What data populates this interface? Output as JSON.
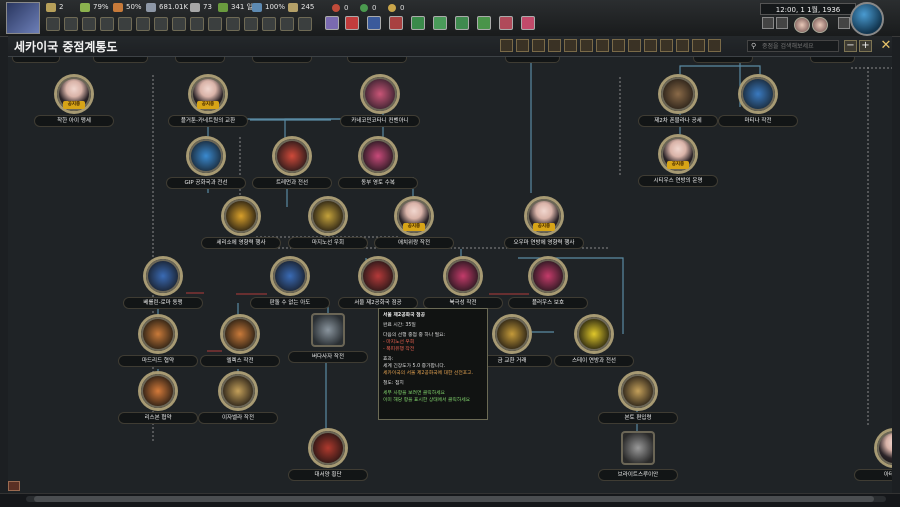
{
  "topbar": {
    "stats": [
      {
        "value": "2",
        "icon": "political-power-icon",
        "color": "#b7a05a"
      },
      {
        "value": "79%",
        "icon": "stability-icon",
        "color": "#8bb24e"
      },
      {
        "value": "50%",
        "icon": "war-support-icon",
        "color": "#c77a3a"
      },
      {
        "value": "681.01K",
        "icon": "manpower-icon",
        "color": "#8d97a6"
      },
      {
        "value": "73",
        "icon": "factory-icon",
        "color": "#a7a7a7"
      },
      {
        "value": "341 일",
        "icon": "fuel-icon",
        "color": "#6a9b3e"
      },
      {
        "value": "100%",
        "icon": "convoy-icon",
        "color": "#5d8ab2"
      },
      {
        "value": "245",
        "icon": "command-power-icon",
        "color": "#b5a168"
      }
    ],
    "war_counters": [
      {
        "value": "0",
        "color": "#c04b3a"
      },
      {
        "value": "0",
        "color": "#4b9a4f"
      },
      {
        "value": "0",
        "color": "#c9a54a"
      }
    ],
    "clock": "12:00, 1 1월, 1936"
  },
  "header": {
    "title": "세카이국 중점계통도",
    "search_placeholder": "중점을 검색해보세요",
    "zoom_out": "−",
    "zoom_in": "+",
    "close": "✕"
  },
  "focuses": [
    {
      "id": "f1",
      "label": "착한 아이 맹세",
      "portrait": true,
      "tag": "공지중",
      "color": "#e8d0c6"
    },
    {
      "id": "f2",
      "label": "플거툰-카네트원의 교환",
      "portrait": true,
      "tag": "공지중",
      "color": "#e8d0c6"
    },
    {
      "id": "f3",
      "label": "카네코민코타니 컨벤아니",
      "portrait": false,
      "color": "#a33a4c"
    },
    {
      "id": "f4",
      "label": "제2차 폰블라나 공세",
      "portrait": false,
      "color": "#7a5b3a"
    },
    {
      "id": "f5",
      "label": "마티나 작전",
      "portrait": false,
      "color": "#2b6fb0"
    },
    {
      "id": "f6",
      "label": "GIP 공화국과 전선",
      "portrait": false,
      "color": "#2f7fc2"
    },
    {
      "id": "f7",
      "label": "트레먼과 전선",
      "portrait": false,
      "color": "#cc3b36"
    },
    {
      "id": "f8",
      "label": "동부 영토 수복",
      "portrait": false,
      "color": "#c0346c"
    },
    {
      "id": "f9",
      "label": "시티우스 연방의 운명",
      "portrait": true,
      "tag": "공지중",
      "color": "#e8d0c6"
    },
    {
      "id": "f10",
      "label": "세리소에 영향력 행사",
      "portrait": false,
      "color": "#d9a02a"
    },
    {
      "id": "f11",
      "label": "마지노선 우회",
      "portrait": false,
      "color": "#c4a23b"
    },
    {
      "id": "f12",
      "label": "애치위랑 작전",
      "portrait": true,
      "tag": "공지중",
      "color": "#e8d0c6"
    },
    {
      "id": "f13",
      "label": "오우마 연방에 영향력 행사",
      "portrait": true,
      "tag": "공지중",
      "color": "#e8d0c6"
    },
    {
      "id": "f14",
      "label": "베를린-로마 동맹",
      "portrait": false,
      "color": "#3a6bb5"
    },
    {
      "id": "f15",
      "label": "판돌 수 없는 아도",
      "portrait": false,
      "color": "#3a6bb5"
    },
    {
      "id": "f16",
      "label": "서울 제2공화국 점공",
      "portrait": false,
      "color": "#b53a3a"
    },
    {
      "id": "f17",
      "label": "북극성 작전",
      "portrait": false,
      "color": "#c43b6a"
    },
    {
      "id": "f18",
      "label": "플러우스 보호",
      "portrait": false,
      "color": "#c43b6a"
    },
    {
      "id": "f19",
      "label": "마드리드 협약",
      "portrait": false,
      "color": "#c97a3a"
    },
    {
      "id": "f20",
      "label": "엘렉스 작전",
      "portrait": false,
      "color": "#c97a3a"
    },
    {
      "id": "f21",
      "label": "버다사자 작전",
      "portrait": false,
      "color": "#6e7880"
    },
    {
      "id": "f22",
      "label": "금 교환 거래",
      "portrait": false,
      "color": "#c49a3a"
    },
    {
      "id": "f23",
      "label": "스테이 연방과 전선",
      "portrait": false,
      "color": "#e0c82a"
    },
    {
      "id": "f24",
      "label": "리스본 협약",
      "portrait": false,
      "color": "#d47a3a"
    },
    {
      "id": "f25",
      "label": "이자벨라 작전",
      "portrait": false,
      "color": "#c4a05a"
    },
    {
      "id": "f26",
      "label": "본토 편입령",
      "portrait": false,
      "color": "#c4a05a"
    },
    {
      "id": "f27",
      "label": "대서양 횡단",
      "portrait": false,
      "color": "#b03a2e"
    },
    {
      "id": "f28",
      "label": "브라이트스루이안",
      "portrait": false,
      "color": "#8a8a8a"
    },
    {
      "id": "f29",
      "label": "아테리카",
      "portrait": true,
      "color": "#e8d0c6"
    }
  ],
  "tooltip": {
    "title": "서울 제2공화국 점공",
    "duration": "완료 시간: 35일",
    "requires": "다음의 선행 중점 중 하나 필요:",
    "req1": "- 마지노선 우회",
    "req2": "- 폭피유행 작전",
    "effect_head": "효과:",
    "effect1": "세계 긴장도가 5.0 증가합니다.",
    "effect2": "세카이국의 서울 제2공화국에 대한 선전포고.",
    "ai_head": "철도: 점치",
    "foot1": "세부 사항을 보려면 클릭하세요",
    "foot2": "이미 해당 항을 표시한 상태에서 클릭하세요"
  }
}
